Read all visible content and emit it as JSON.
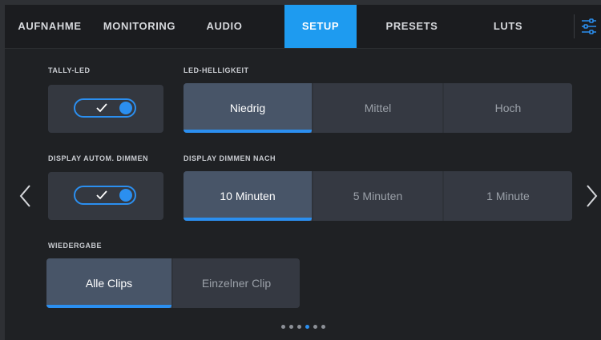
{
  "tabs": [
    {
      "label": "AUFNAHME"
    },
    {
      "label": "MONITORING"
    },
    {
      "label": "AUDIO"
    },
    {
      "label": "SETUP"
    },
    {
      "label": "PRESETS"
    },
    {
      "label": "LUTS"
    }
  ],
  "active_tab": "SETUP",
  "icons": {
    "menu": "sliders-icon",
    "prev": "chevron-left-icon",
    "next": "chevron-right-icon",
    "check": "check-icon"
  },
  "colors": {
    "accent": "#1e9bf0",
    "selected_segment": "#485568",
    "background": "#1f2124"
  },
  "tally_led": {
    "label": "TALLY-LED",
    "on": true
  },
  "led_brightness": {
    "label": "LED-HELLIGKEIT",
    "options": [
      "Niedrig",
      "Mittel",
      "Hoch"
    ],
    "selected": "Niedrig"
  },
  "display_auto_dim": {
    "label": "DISPLAY AUTOM. DIMMEN",
    "on": true
  },
  "dim_after": {
    "label": "DISPLAY DIMMEN NACH",
    "options": [
      "10 Minuten",
      "5 Minuten",
      "1 Minute"
    ],
    "selected": "10 Minuten"
  },
  "playback": {
    "label": "WIEDERGABE",
    "options": [
      "Alle Clips",
      "Einzelner Clip"
    ],
    "selected": "Alle Clips"
  },
  "pagination": {
    "total": 6,
    "current": 3
  }
}
